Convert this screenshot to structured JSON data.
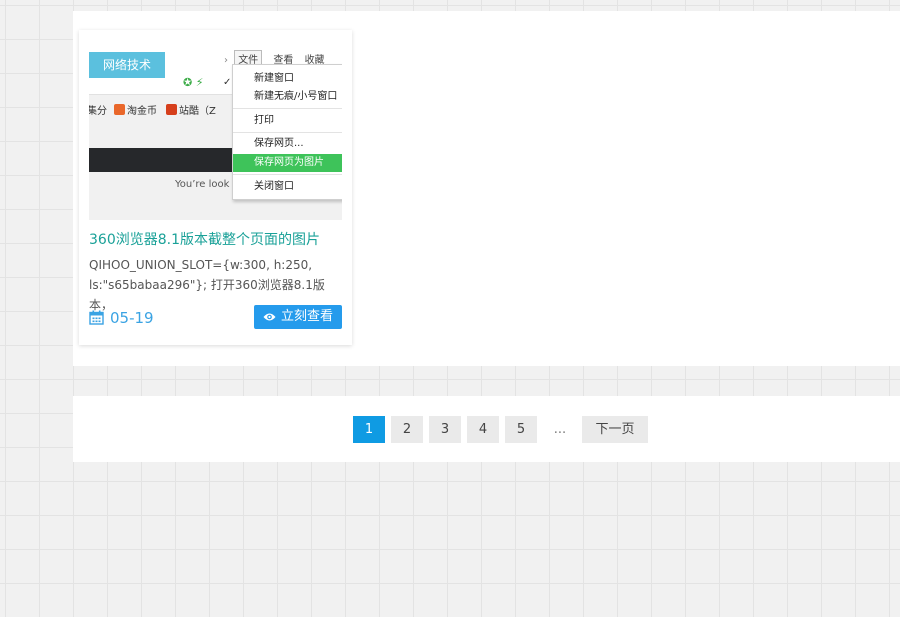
{
  "post": {
    "category_tag": "网络技术",
    "title": "360浏览器8.1版本截整个页面的图片",
    "excerpt": "QIHOO_UNION_SLOT={w:300, h:250, ls:\"s65babaa296\"}; 打开360浏览器8.1版本，",
    "date": "05-19",
    "view_button_label": "立刻查看",
    "thumbnail": {
      "menubar": [
        "文件",
        "查看",
        "收藏"
      ],
      "bookmarks": [
        "集分",
        "淘金币",
        "站酷（Z"
      ],
      "menu_items": [
        "新建窗口",
        "新建无痕/小号窗口",
        "打印",
        "保存网页...",
        "保存网页为图片",
        "关闭窗口"
      ],
      "highlighted_item": "保存网页为图片",
      "page_text": "You’re look"
    }
  },
  "pagination": {
    "pages": [
      "1",
      "2",
      "3",
      "4",
      "5"
    ],
    "current": "1",
    "ellipsis": "...",
    "next_label": "下一页"
  },
  "colors": {
    "accent": "#259bec",
    "title": "#1aa198",
    "tag": "#5bc0de",
    "current_page": "#0f9be3"
  }
}
